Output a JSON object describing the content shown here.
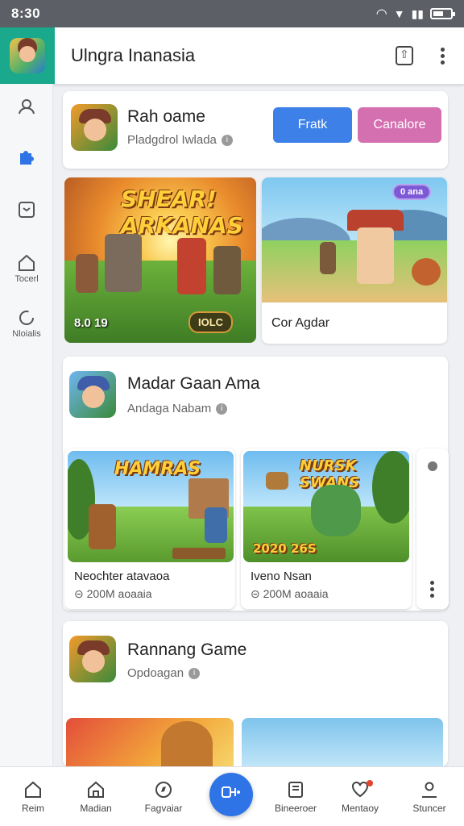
{
  "status": {
    "time": "8:30"
  },
  "header": {
    "title": "Ulngra Inanasia"
  },
  "rail": [
    {
      "label": "",
      "icon": "profile-icon"
    },
    {
      "label": "",
      "icon": "puzzle-icon"
    },
    {
      "label": "",
      "icon": "box-icon"
    },
    {
      "label": "Tocerl",
      "icon": "home-icon"
    },
    {
      "label": "Nloialis",
      "icon": "refresh-icon"
    }
  ],
  "card1": {
    "title": "Rah oame",
    "subtitle": "Pladgdrol Iwlada",
    "btn_primary": "Fratk",
    "btn_secondary": "Canalore",
    "colors": {
      "primary": "#3c80e8",
      "secondary": "#d46fb0"
    }
  },
  "featured": {
    "left_banner": "SHEAR! ARKANAS",
    "left_stamp": "8.0 19",
    "left_pill": "IOLC",
    "right_caption": "Cor Agdar",
    "right_badge": "0 ana"
  },
  "card2": {
    "title": "Madar Gaan Ama",
    "subtitle": "Andaga Nabam",
    "items": [
      {
        "banner": "HAMRAS",
        "corner": "",
        "caption": "Neochter atavaoa",
        "meta": "200M aoaaia"
      },
      {
        "banner": "NURSK SWANS",
        "corner": "2020 26S",
        "caption": "Iveno Nsan",
        "meta": "200M aoaaia"
      }
    ]
  },
  "card3": {
    "title": "Rannang Game",
    "subtitle": "Opdoagan"
  },
  "bottom_nav": [
    {
      "label": "Reim",
      "icon": "home-icon"
    },
    {
      "label": "Madian",
      "icon": "house-icon"
    },
    {
      "label": "Fagvaiar",
      "icon": "compass-icon"
    },
    {
      "label": "",
      "icon": "gamepad-icon"
    },
    {
      "label": "Bineeroer",
      "icon": "library-icon"
    },
    {
      "label": "Mentaoy",
      "icon": "heart-icon"
    },
    {
      "label": "Stuncer",
      "icon": "person-icon"
    }
  ]
}
